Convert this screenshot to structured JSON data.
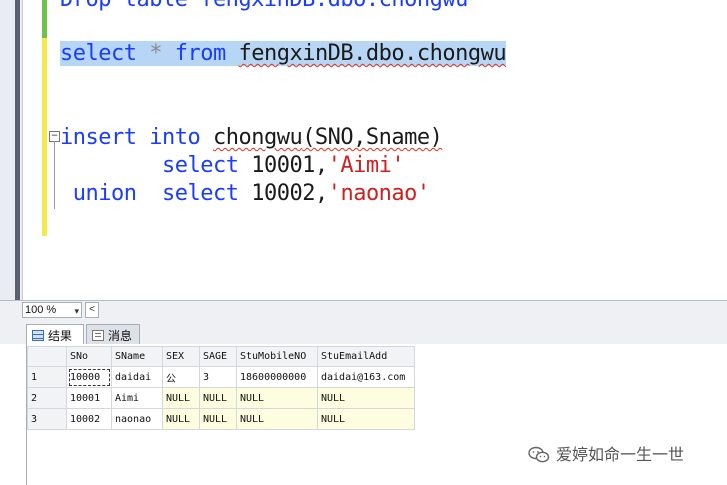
{
  "editor": {
    "line_drop": "Drop table fengxinDB.dbo.chongwu",
    "select_kw": "select",
    "select_star": "*",
    "select_from": "from",
    "select_object": "fengxinDB.dbo.chongwu",
    "insert_kw": "insert",
    "into_kw": "into",
    "insert_table": "chongwu",
    "insert_cols": "(SNO,Sname)",
    "sel1_kw": "select",
    "sel1_num": "10001,",
    "sel1_str": "'Aimi'",
    "union_kw": "union",
    "sel2_kw": "select",
    "sel2_num": "10002,",
    "sel2_str": "'naonao'",
    "outline_glyph": "−"
  },
  "statusbar": {
    "zoom": "100 %",
    "zoom_arrow": "▾",
    "scroll_left": "<"
  },
  "tabs": {
    "results": "结果",
    "messages": "消息"
  },
  "results": {
    "columns": [
      "SNo",
      "SName",
      "SEX",
      "SAGE",
      "StuMobileNO",
      "StuEmailAdd"
    ],
    "rows": [
      {
        "n": "1",
        "cells": [
          "10000",
          "daidai",
          "公",
          "3",
          "18600000000",
          "daidai@163.com"
        ]
      },
      {
        "n": "2",
        "cells": [
          "10001",
          "Aimi",
          "NULL",
          "NULL",
          "NULL",
          "NULL"
        ]
      },
      {
        "n": "3",
        "cells": [
          "10002",
          "naonao",
          "NULL",
          "NULL",
          "NULL",
          "NULL"
        ]
      }
    ]
  },
  "watermark": {
    "text": "爱婷如命一生一世",
    "icon": "wechat-icon"
  },
  "colors": {
    "keyword": "#1a3cff",
    "string": "#d02020",
    "selection": "#b7d6f5",
    "null_cell": "#fffde0"
  }
}
